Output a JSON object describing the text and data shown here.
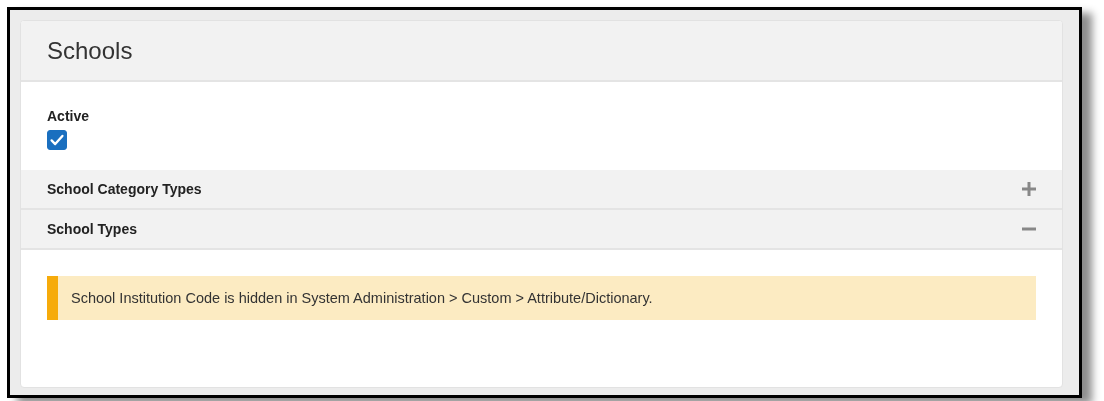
{
  "panel": {
    "title": "Schools"
  },
  "active": {
    "label": "Active",
    "checked": true
  },
  "sections": [
    {
      "title": "School Category Types",
      "expanded": false
    },
    {
      "title": "School Types",
      "expanded": true,
      "alert": "School Institution Code is hidden in System Administration > Custom > Attribute/Dictionary."
    }
  ]
}
